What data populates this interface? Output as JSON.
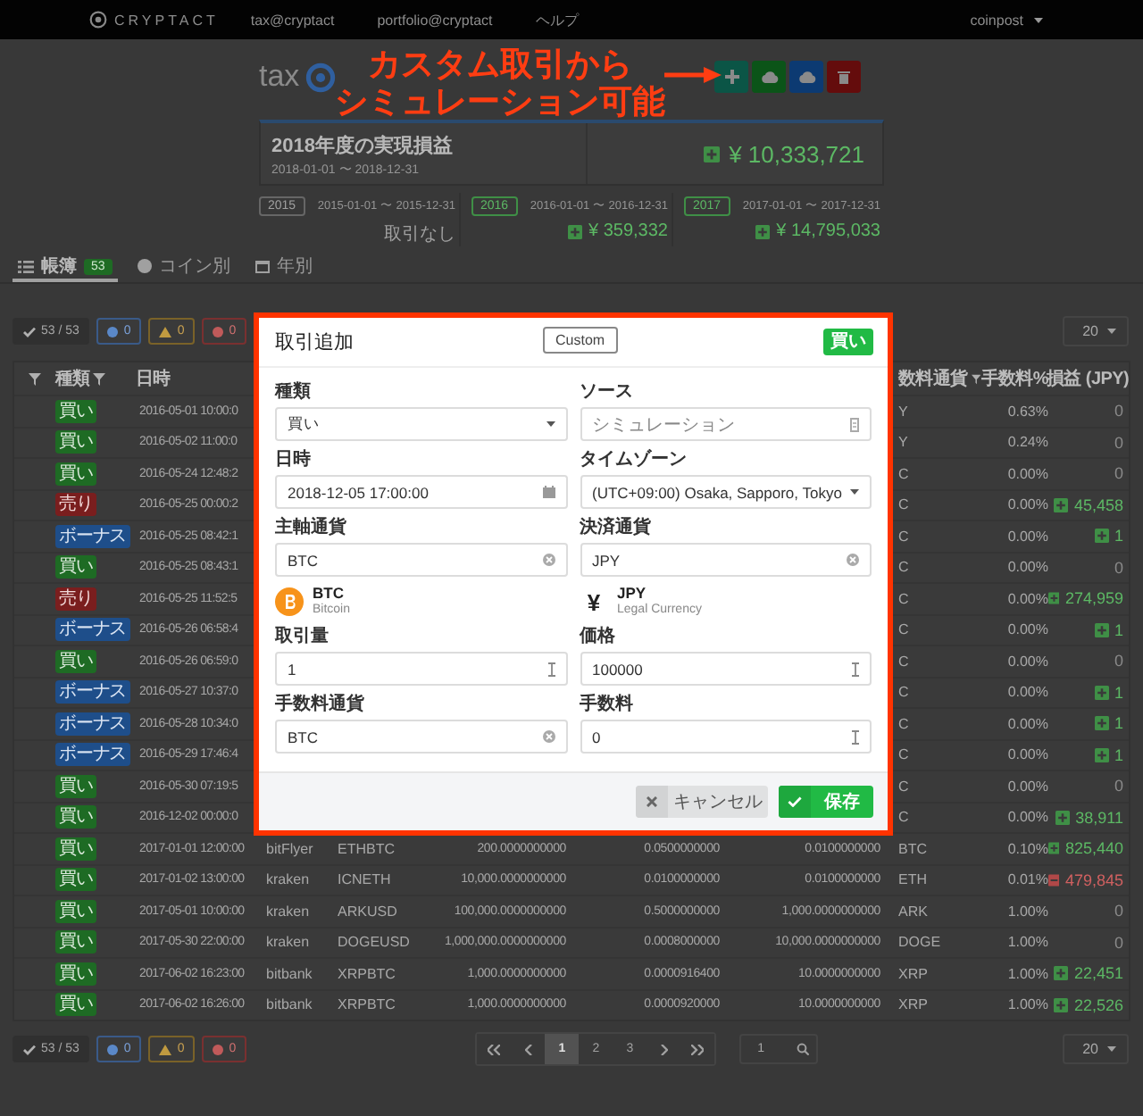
{
  "nav": {
    "brand": "CRYPTACT",
    "links": [
      "tax@cryptact",
      "portfolio@cryptact",
      "ヘルプ"
    ],
    "user": "coinpost"
  },
  "header": {
    "logo": "tax",
    "annotation": [
      "カスタム取引から",
      "シミュレーション可能"
    ],
    "actions": [
      {
        "kind": "add"
      },
      {
        "kind": "download"
      },
      {
        "kind": "upload"
      },
      {
        "kind": "delete"
      }
    ]
  },
  "summary": {
    "title": "2018年度の実現損益",
    "range": "2018-01-01 〜 2018-12-31",
    "value": {
      "kind": "gain",
      "text": "¥ 10,333,721"
    }
  },
  "years": [
    {
      "year": "2015",
      "range": "2015-01-01 〜 2015-12-31",
      "value": {
        "kind": "zero",
        "text": "取引なし"
      }
    },
    {
      "year": "2016",
      "range": "2016-01-01 〜 2016-12-31",
      "value": {
        "kind": "gain",
        "text": "¥ 359,332"
      }
    },
    {
      "year": "2017",
      "range": "2017-01-01 〜 2017-12-31",
      "value": {
        "kind": "gain",
        "text": "¥ 14,795,033"
      }
    }
  ],
  "tabs": [
    {
      "label": "帳簿",
      "badge": "53",
      "selected": true
    },
    {
      "label": "コイン別",
      "selected": false
    },
    {
      "label": "年別",
      "selected": false
    }
  ],
  "filters": [
    {
      "kind": "ok",
      "label": "53 / 53"
    },
    {
      "kind": "info",
      "label": "0"
    },
    {
      "kind": "warning",
      "label": "0"
    },
    {
      "kind": "error",
      "label": "0"
    }
  ],
  "page_size": "20",
  "table": {
    "columns": [
      {
        "label": "種類",
        "filter": true
      },
      {
        "label": "日時",
        "filter": false
      },
      {
        "label": "数料通貨",
        "filter": true
      },
      {
        "label": "手数料%",
        "filter": false
      },
      {
        "label": "損益 (JPY)",
        "filter": false
      }
    ],
    "rows": [
      {
        "kind": "buy",
        "type": "買い",
        "date": "2016-05-01 10:00:0",
        "fee_currency": "Y",
        "fee_rate": "0.63%",
        "pnl": {
          "kind": "zero",
          "text": "0"
        }
      },
      {
        "kind": "buy",
        "type": "買い",
        "date": "2016-05-02 11:00:0",
        "fee_currency": "Y",
        "fee_rate": "0.24%",
        "pnl": {
          "kind": "zero",
          "text": "0"
        }
      },
      {
        "kind": "buy",
        "type": "買い",
        "date": "2016-05-24 12:48:2",
        "fee_currency": "C",
        "fee_rate": "0.00%",
        "pnl": {
          "kind": "zero",
          "text": "0"
        }
      },
      {
        "kind": "sell",
        "type": "売り",
        "date": "2016-05-25 00:00:2",
        "fee_currency": "C",
        "fee_rate": "0.00%",
        "pnl": {
          "kind": "gain",
          "text": "45,458"
        }
      },
      {
        "kind": "bonus",
        "type": "ボーナス",
        "date": "2016-05-25 08:42:1",
        "fee_currency": "C",
        "fee_rate": "0.00%",
        "pnl": {
          "kind": "gain",
          "text": "1"
        }
      },
      {
        "kind": "buy",
        "type": "買い",
        "date": "2016-05-25 08:43:1",
        "fee_currency": "C",
        "fee_rate": "0.00%",
        "pnl": {
          "kind": "zero",
          "text": "0"
        }
      },
      {
        "kind": "sell",
        "type": "売り",
        "date": "2016-05-25 11:52:5",
        "fee_currency": "C",
        "fee_rate": "0.00%",
        "pnl": {
          "kind": "gain",
          "text": "274,959"
        }
      },
      {
        "kind": "bonus",
        "type": "ボーナス",
        "date": "2016-05-26 06:58:4",
        "fee_currency": "C",
        "fee_rate": "0.00%",
        "pnl": {
          "kind": "gain",
          "text": "1"
        }
      },
      {
        "kind": "buy",
        "type": "買い",
        "date": "2016-05-26 06:59:0",
        "fee_currency": "C",
        "fee_rate": "0.00%",
        "pnl": {
          "kind": "zero",
          "text": "0"
        }
      },
      {
        "kind": "bonus",
        "type": "ボーナス",
        "date": "2016-05-27 10:37:0",
        "fee_currency": "C",
        "fee_rate": "0.00%",
        "pnl": {
          "kind": "gain",
          "text": "1"
        }
      },
      {
        "kind": "bonus",
        "type": "ボーナス",
        "date": "2016-05-28 10:34:0",
        "fee_currency": "C",
        "fee_rate": "0.00%",
        "pnl": {
          "kind": "gain",
          "text": "1"
        }
      },
      {
        "kind": "bonus",
        "type": "ボーナス",
        "date": "2016-05-29 17:46:4",
        "fee_currency": "C",
        "fee_rate": "0.00%",
        "pnl": {
          "kind": "gain",
          "text": "1"
        }
      },
      {
        "kind": "buy",
        "type": "買い",
        "date": "2016-05-30 07:19:5",
        "fee_currency": "C",
        "fee_rate": "0.00%",
        "pnl": {
          "kind": "zero",
          "text": "0"
        }
      },
      {
        "kind": "buy",
        "type": "買い",
        "date": "2016-12-02 00:00:0",
        "fee_currency": "C",
        "fee_rate": "0.00%",
        "pnl": {
          "kind": "gain",
          "text": "38,911"
        }
      },
      {
        "kind": "buy",
        "type": "買い",
        "date": "2017-01-01 12:00:00",
        "exchange": "bitFlyer",
        "pair": "ETHBTC",
        "column_6": "200.0000000000",
        "column_7": "0.0500000000",
        "column_8": "0.0100000000",
        "fee_currency": "BTC",
        "fee_rate": "0.10%",
        "pnl": {
          "kind": "gain",
          "text": "825,440"
        }
      },
      {
        "kind": "buy",
        "type": "買い",
        "date": "2017-01-02 13:00:00",
        "exchange": "kraken",
        "pair": "ICNETH",
        "column_6": "10,000.0000000000",
        "column_7": "0.0100000000",
        "column_8": "0.0100000000",
        "fee_currency": "ETH",
        "fee_rate": "0.01%",
        "pnl": {
          "kind": "loss",
          "text": "479,845"
        }
      },
      {
        "kind": "buy",
        "type": "買い",
        "date": "2017-05-01 10:00:00",
        "exchange": "kraken",
        "pair": "ARKUSD",
        "column_6": "100,000.0000000000",
        "column_7": "0.5000000000",
        "column_8": "1,000.0000000000",
        "fee_currency": "ARK",
        "fee_rate": "1.00%",
        "pnl": {
          "kind": "zero",
          "text": "0"
        }
      },
      {
        "kind": "buy",
        "type": "買い",
        "date": "2017-05-30 22:00:00",
        "exchange": "kraken",
        "pair": "DOGEUSD",
        "column_6": "1,000,000.0000000000",
        "column_7": "0.0008000000",
        "column_8": "10,000.0000000000",
        "fee_currency": "DOGE",
        "fee_rate": "1.00%",
        "pnl": {
          "kind": "zero",
          "text": "0"
        }
      },
      {
        "kind": "buy",
        "type": "買い",
        "date": "2017-06-02 16:23:00",
        "exchange": "bitbank",
        "pair": "XRPBTC",
        "column_6": "1,000.0000000000",
        "column_7": "0.0000916400",
        "column_8": "10.0000000000",
        "fee_currency": "XRP",
        "fee_rate": "1.00%",
        "pnl": {
          "kind": "gain",
          "text": "22,451"
        }
      },
      {
        "kind": "buy",
        "type": "買い",
        "date": "2017-06-02 16:26:00",
        "exchange": "bitbank",
        "pair": "XRPBTC",
        "column_6": "1,000.0000000000",
        "column_7": "0.0000920000",
        "column_8": "10.0000000000",
        "fee_currency": "XRP",
        "fee_rate": "1.00%",
        "pnl": {
          "kind": "gain",
          "text": "22,526"
        }
      }
    ]
  },
  "footer_filters": [
    {
      "kind": "ok",
      "label": "53 / 53"
    },
    {
      "kind": "info",
      "label": "0"
    },
    {
      "kind": "warning",
      "label": "0"
    },
    {
      "kind": "error",
      "label": "0"
    }
  ],
  "pagination": {
    "pages": [
      {
        "label": "1",
        "selected": true
      },
      {
        "label": "2",
        "selected": false
      },
      {
        "label": "3",
        "selected": false
      }
    ],
    "jump": "1"
  },
  "footer_page_size": "20",
  "dialog": {
    "title": "取引追加",
    "mode": "Custom",
    "type": "買い",
    "items": [
      {
        "kind": "select",
        "label": "種類",
        "value": "買い"
      },
      {
        "kind": "text",
        "label": "ソース",
        "placeholder": "シミュレーション"
      },
      {
        "kind": "date",
        "label": "日時",
        "value": "2018-12-05 17:00:00"
      },
      {
        "kind": "select",
        "label": "タイムゾーン",
        "value": "(UTC+09:00) Osaka, Sapporo, Tokyo"
      },
      {
        "kind": "currency",
        "label": "主軸通貨",
        "value": "BTC"
      },
      {
        "kind": "currency",
        "label": "決済通貨",
        "value": "JPY"
      },
      {
        "kind": "crypto",
        "code": "BTC",
        "name": "Bitcoin"
      },
      {
        "kind": "fiat",
        "symbol": "¥",
        "code": "JPY",
        "name": "Legal Currency"
      },
      {
        "kind": "number",
        "label": "取引量",
        "value": "1"
      },
      {
        "kind": "number",
        "label": "価格",
        "value": "100000"
      },
      {
        "kind": "currency",
        "label": "手数料通貨",
        "value": "BTC"
      },
      {
        "kind": "number",
        "label": "手数料",
        "value": "0"
      }
    ],
    "buttons": [
      {
        "kind": "cancel",
        "label": "キャンセル"
      },
      {
        "kind": "save",
        "label": "保存"
      }
    ]
  }
}
